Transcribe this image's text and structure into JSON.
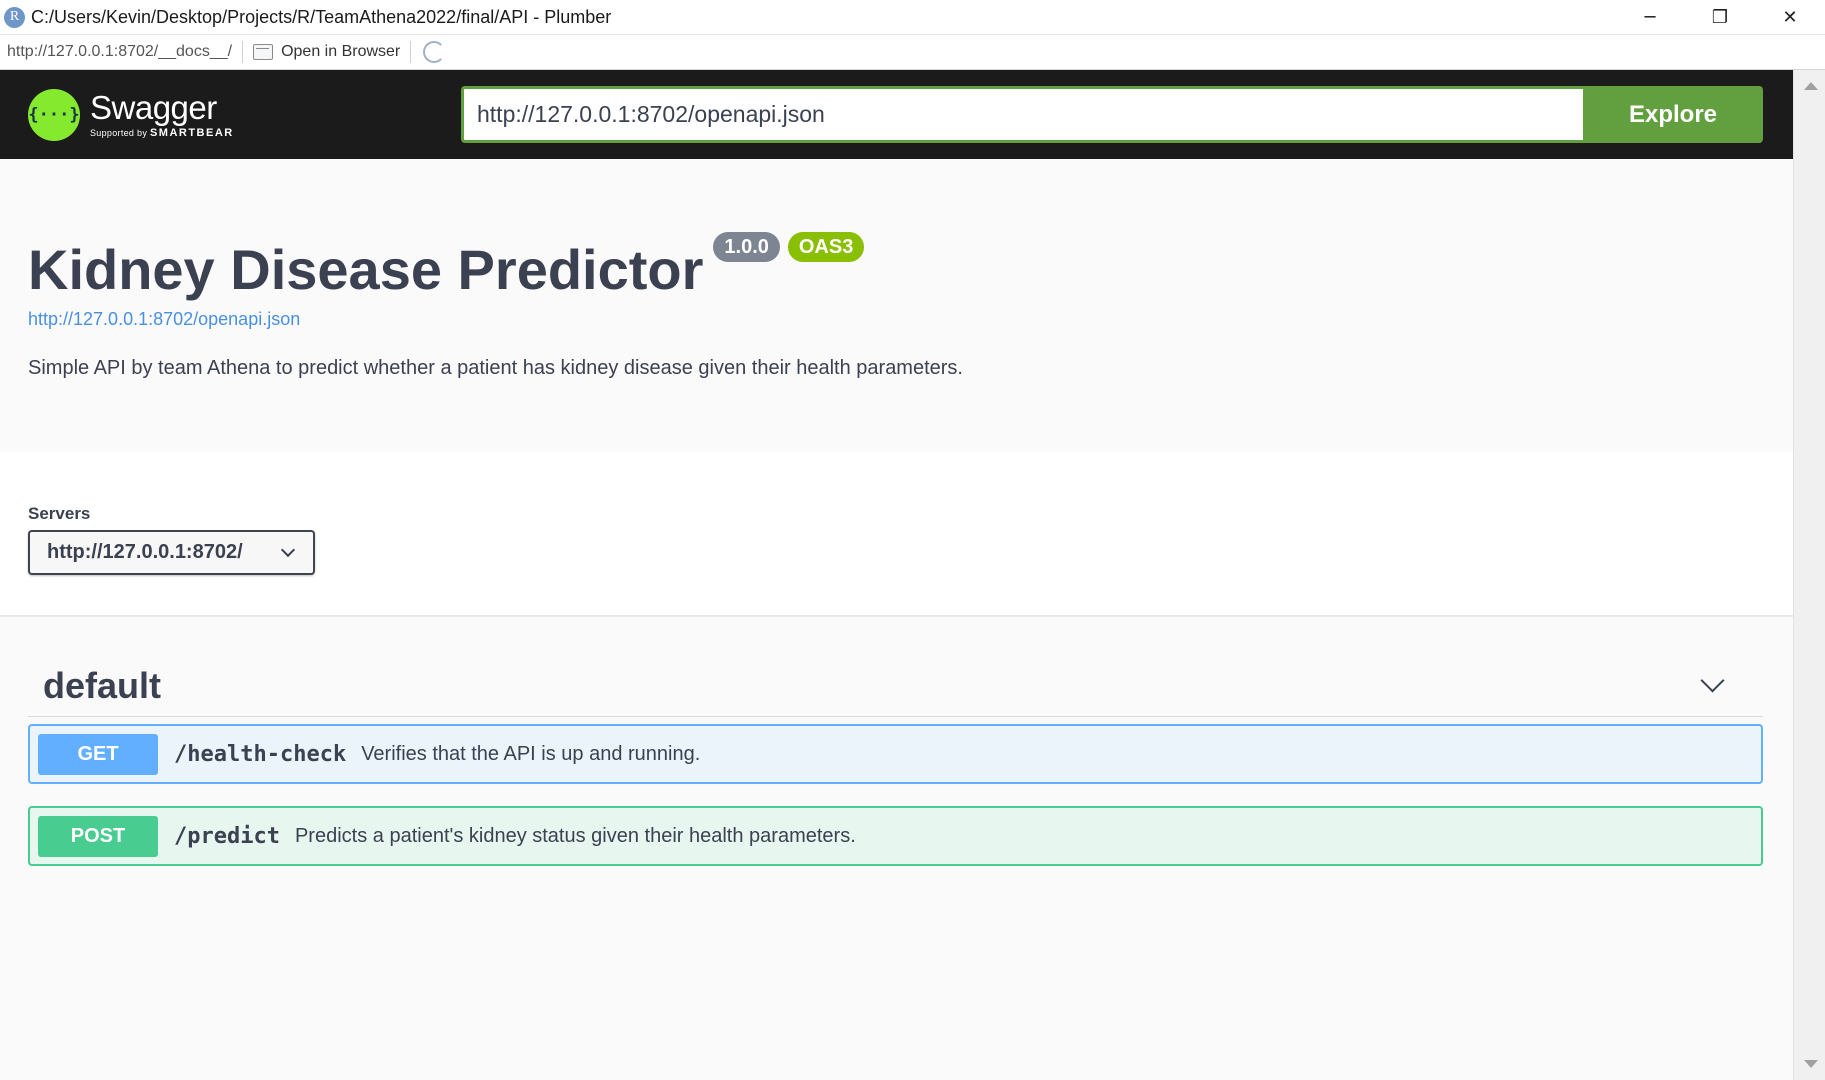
{
  "window": {
    "title": "C:/Users/Kevin/Desktop/Projects/R/TeamAthena2022/final/API - Plumber",
    "app_icon_letter": "R",
    "controls": {
      "minimize": "─",
      "restore": "❐",
      "close": "✕"
    }
  },
  "toolbar": {
    "url": "http://127.0.0.1:8702/__docs__/",
    "open_in_browser": "Open in Browser"
  },
  "topbar": {
    "brand": "Swagger",
    "supported_by": "Supported by",
    "smartbear": "SMARTBEAR",
    "logo_glyph": "{···}",
    "spec_url": "http://127.0.0.1:8702/openapi.json",
    "explore_label": "Explore"
  },
  "info": {
    "title": "Kidney Disease Predictor",
    "version_badge": "1.0.0",
    "oas_badge": "OAS3",
    "spec_link": "http://127.0.0.1:8702/openapi.json",
    "description": "Simple API by team Athena to predict whether a patient has kidney disease given their health parameters."
  },
  "servers": {
    "label": "Servers",
    "selected": "http://127.0.0.1:8702/"
  },
  "operations": {
    "tag": "default",
    "items": [
      {
        "method": "GET",
        "path": "/health-check",
        "summary": "Verifies that the API is up and running."
      },
      {
        "method": "POST",
        "path": "/predict",
        "summary": "Predicts a patient's kidney status given their health parameters."
      }
    ]
  },
  "colors": {
    "topbar_bg": "#1b1b1b",
    "swagger_green": "#85ea2d",
    "explore_green": "#62a03f",
    "get_blue": "#61affe",
    "post_green": "#49cc90",
    "version_badge": "#7d8492",
    "oas_badge": "#89bf04",
    "link_blue": "#4990e2"
  }
}
